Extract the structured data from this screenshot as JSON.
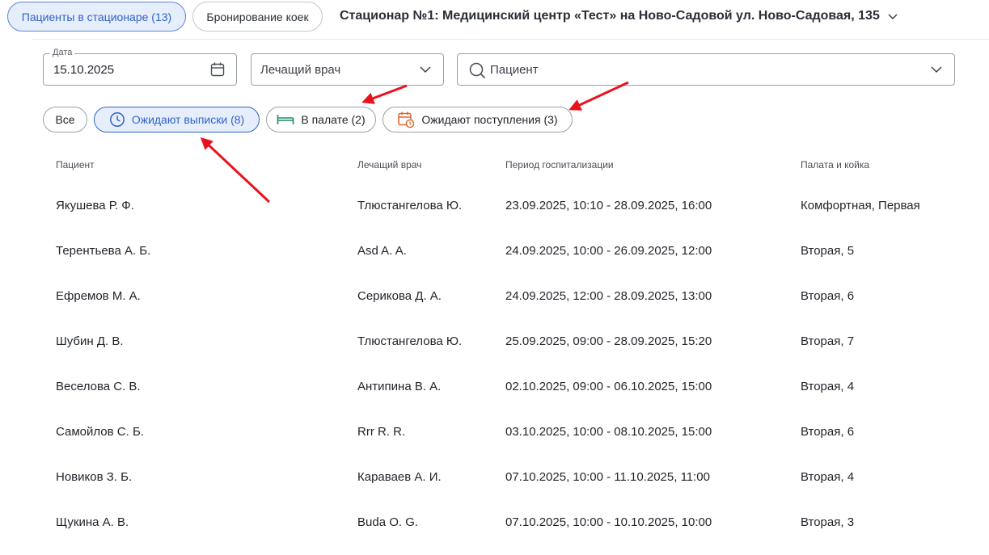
{
  "header": {
    "tabs": [
      {
        "label": "Пациенты в стационаре (13)",
        "active": true
      },
      {
        "label": "Бронирование коек",
        "active": false
      }
    ],
    "clinic_prefix": "Стационар №1:",
    "clinic_name": " Медицинский центр «Тест» на Ново-Садовой ул. Ново-Садовая, 135"
  },
  "filters": {
    "date": {
      "label": "Дата",
      "value": "15.10.2025"
    },
    "doctor": {
      "placeholder": "Лечащий врач"
    },
    "patient": {
      "placeholder": "Пациент"
    }
  },
  "chips": [
    {
      "label": "Все",
      "active": false
    },
    {
      "label": "Ожидают выписки (8)",
      "active": true,
      "icon": "clock-icon"
    },
    {
      "label": "В палате (2)",
      "active": false,
      "icon": "bed-icon"
    },
    {
      "label": "Ожидают поступления (3)",
      "active": false,
      "icon": "calendar-clock-icon"
    }
  ],
  "table": {
    "columns": [
      "Пациент",
      "Лечащий врач",
      "Период госпитализации",
      "Палата и койка"
    ],
    "rows": [
      [
        "Якушева Р. Ф.",
        "Тлюстангелова Ю.",
        "23.09.2025, 10:10 - 28.09.2025, 16:00",
        "Комфортная, Первая"
      ],
      [
        "Терентьева А. Б.",
        "Asd A. A.",
        "24.09.2025, 10:00 - 26.09.2025, 12:00",
        "Вторая, 5"
      ],
      [
        "Ефремов М. А.",
        "Серикова Д. А.",
        "24.09.2025, 12:00 - 28.09.2025, 13:00",
        "Вторая, 6"
      ],
      [
        "Шубин Д. В.",
        "Тлюстангелова Ю.",
        "25.09.2025, 09:00 - 28.09.2025, 15:20",
        "Вторая, 7"
      ],
      [
        "Веселова С. В.",
        "Антипина В. А.",
        "02.10.2025, 09:00 - 06.10.2025, 15:00",
        "Вторая, 4"
      ],
      [
        "Самойлов С. Б.",
        "Rrr R. R.",
        "03.10.2025, 10:00 - 08.10.2025, 15:00",
        "Вторая, 6"
      ],
      [
        "Новиков З. Б.",
        "Караваев А. И.",
        "07.10.2025, 10:00 - 11.10.2025, 11:00",
        "Вторая, 4"
      ],
      [
        "Щукина А. В.",
        "Buda O. G.",
        "07.10.2025, 10:00 - 10.10.2025, 10:00",
        "Вторая, 3"
      ]
    ]
  },
  "colors": {
    "accent": "#2f63c9",
    "accent_bg": "#e7eefb",
    "bed_icon": "#1f8a6e",
    "calendar_icon": "#e0662a",
    "annotation_arrow": "#e8121c"
  }
}
